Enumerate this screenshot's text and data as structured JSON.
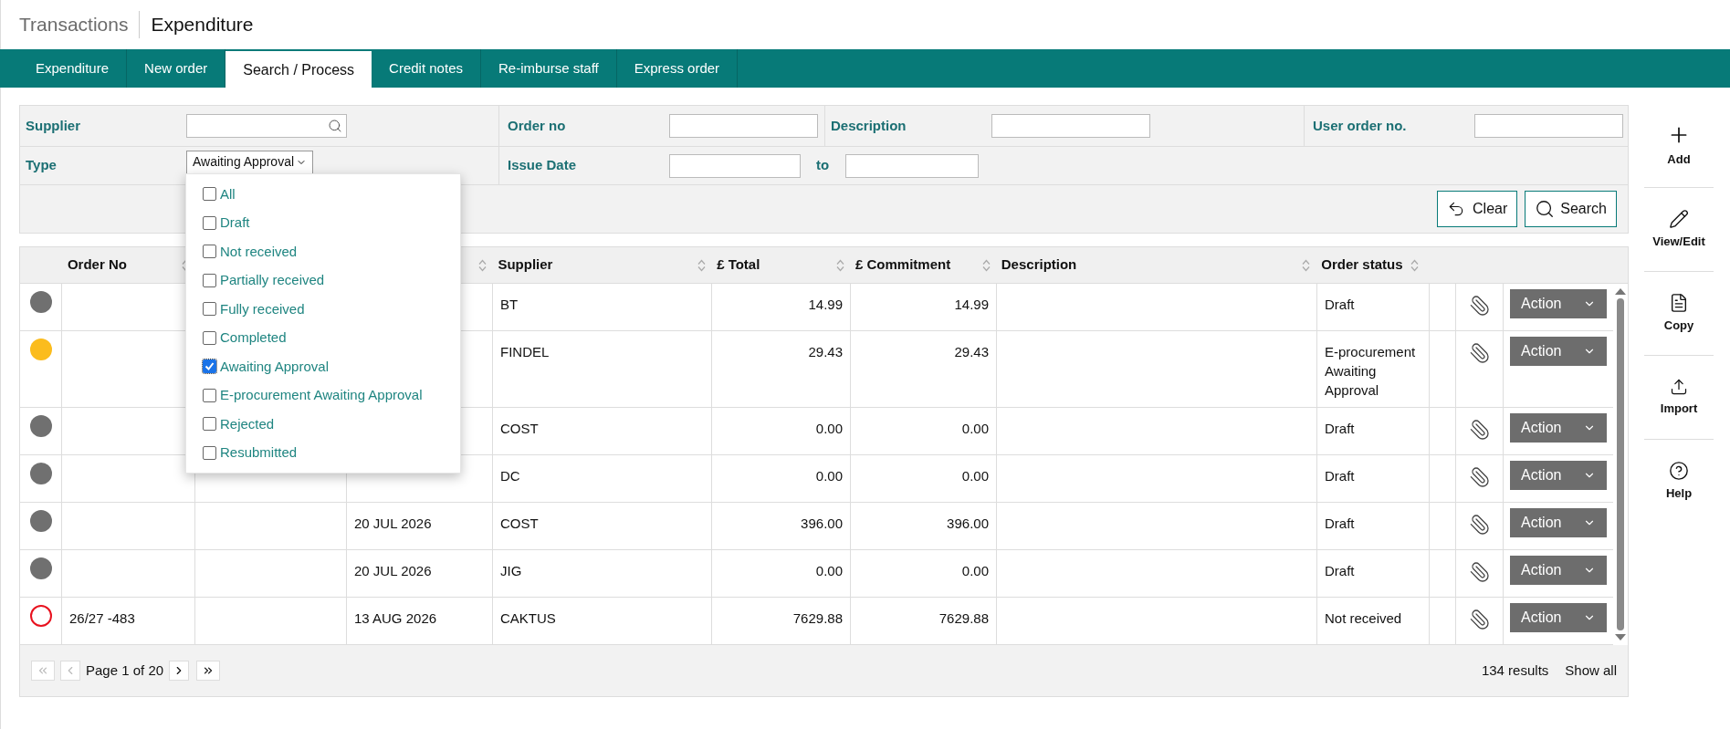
{
  "header": {
    "section": "Transactions",
    "title": "Expenditure"
  },
  "tabs": [
    {
      "label": "Expenditure",
      "selected": false
    },
    {
      "label": "New order",
      "selected": false
    },
    {
      "label": "Search / Process",
      "selected": true
    },
    {
      "label": "Credit notes",
      "selected": false
    },
    {
      "label": "Re-imburse staff",
      "selected": false
    },
    {
      "label": "Express order",
      "selected": false
    }
  ],
  "filters": {
    "supplier": {
      "label": "Supplier"
    },
    "order_no": {
      "label": "Order no"
    },
    "description": {
      "label": "Description"
    },
    "user_order_no": {
      "label": "User order no."
    },
    "type": {
      "label": "Type",
      "value": "Awaiting Approval"
    },
    "issue_date": {
      "label": "Issue Date",
      "to_label": "to"
    }
  },
  "buttons": {
    "clear": "Clear",
    "search": "Search"
  },
  "type_menu": [
    {
      "label": "All",
      "checked": false
    },
    {
      "label": "Draft",
      "checked": false
    },
    {
      "label": "Not received",
      "checked": false
    },
    {
      "label": "Partially received",
      "checked": false
    },
    {
      "label": "Fully received",
      "checked": false
    },
    {
      "label": "Completed",
      "checked": false
    },
    {
      "label": "Awaiting Approval",
      "checked": true
    },
    {
      "label": "E-procurement Awaiting Approval",
      "checked": false
    },
    {
      "label": "Rejected",
      "checked": false
    },
    {
      "label": "Resubmitted",
      "checked": false
    }
  ],
  "table": {
    "columns": [
      {
        "kind": "order_no",
        "label": "Order No"
      },
      {
        "kind": "supplier",
        "label": "Supplier"
      },
      {
        "kind": "total",
        "label": "£ Total"
      },
      {
        "kind": "commitment",
        "label": "£ Commitment"
      },
      {
        "kind": "description",
        "label": "Description"
      },
      {
        "kind": "order_status",
        "label": "Order status"
      }
    ],
    "rows": [
      {
        "status": {
          "kind": "dot",
          "color": "#707070"
        },
        "supplier": "BT",
        "total": "14.99",
        "commitment": "14.99",
        "order_status": "Draft",
        "action": "Action"
      },
      {
        "status": {
          "kind": "dot",
          "color": "#fbbc1d"
        },
        "supplier": "FINDEL",
        "total": "29.43",
        "commitment": "29.43",
        "order_status": "E-procurement Awaiting Approval",
        "action": "Action"
      },
      {
        "status": {
          "kind": "dot",
          "color": "#707070"
        },
        "supplier": "COST",
        "total": "0.00",
        "commitment": "0.00",
        "order_status": "Draft",
        "action": "Action"
      },
      {
        "status": {
          "kind": "dot",
          "color": "#707070"
        },
        "supplier": "DC",
        "total": "0.00",
        "commitment": "0.00",
        "order_status": "Draft",
        "action": "Action"
      },
      {
        "status": {
          "kind": "dot",
          "color": "#707070"
        },
        "issue_date": "20 JUL 2026",
        "supplier": "COST",
        "total": "396.00",
        "commitment": "396.00",
        "order_status": "Draft",
        "action": "Action"
      },
      {
        "status": {
          "kind": "dot",
          "color": "#707070"
        },
        "issue_date": "20 JUL 2026",
        "supplier": "JIG",
        "total": "0.00",
        "commitment": "0.00",
        "order_status": "Draft",
        "action": "Action"
      },
      {
        "status": {
          "kind": "ring",
          "color": "#e8121f"
        },
        "order_no": "26/27 -483",
        "issue_date": "13 AUG 2026",
        "supplier": "CAKTUS",
        "total": "7629.88",
        "commitment": "7629.88",
        "order_status": "Not received",
        "action": "Action"
      }
    ]
  },
  "pagination": {
    "page": "Page 1 of 20",
    "results": "134 results",
    "show_all": "Show all"
  },
  "sidebar": [
    {
      "kind": "add",
      "label": "Add"
    },
    {
      "kind": "edit",
      "label": "View/Edit"
    },
    {
      "kind": "copy",
      "label": "Copy"
    },
    {
      "kind": "import",
      "label": "Import"
    },
    {
      "kind": "help",
      "label": "Help"
    }
  ]
}
